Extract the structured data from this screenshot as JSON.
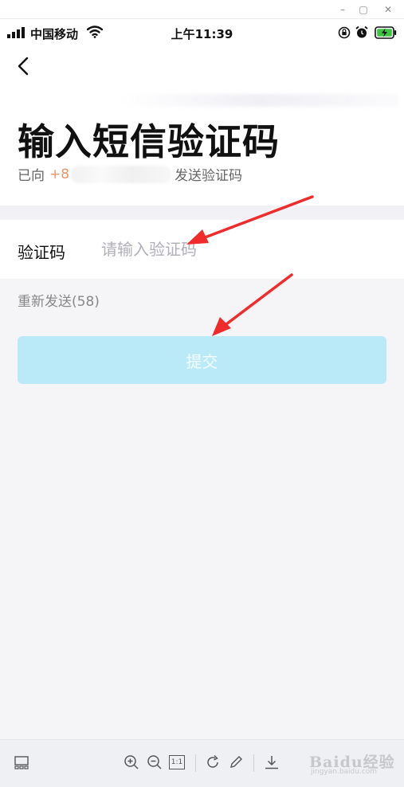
{
  "window": {
    "minimize_glyph": "–",
    "maximize_glyph": "▢",
    "close_glyph": "✕"
  },
  "status_bar": {
    "carrier": "中国移动",
    "time": "上午11:39",
    "icons": [
      "signal-icon",
      "wifi-icon",
      "orientation-lock-icon",
      "alarm-icon",
      "battery-charging-icon"
    ],
    "battery_color": "#3ec43e"
  },
  "header": {
    "back_icon": "chevron-left-icon",
    "title": "输入短信验证码",
    "subtitle_prefix": "已向",
    "phone_prefix": "+8",
    "subtitle_suffix": "发送验证码"
  },
  "form": {
    "code_label": "验证码",
    "code_value": "",
    "code_placeholder": "请输入验证码",
    "resend_label": "重新发送(58)",
    "submit_label": "提交"
  },
  "annotations": {
    "arrow_color": "#ef2b2b",
    "count": 2
  },
  "colors": {
    "accent_phone": "#e8956a",
    "submit_bg": "#baeaf8",
    "page_bg": "#f5f5f8"
  },
  "viewer_toolbar": {
    "icons": [
      "thumbnail-icon",
      "zoom-in-icon",
      "zoom-out-icon",
      "actual-size-icon",
      "rotate-icon",
      "edit-icon",
      "download-icon"
    ],
    "actual_size_label": "1:1"
  },
  "watermark": {
    "brand": "Baidu经验",
    "sub": "jingyan.baidu.com"
  }
}
